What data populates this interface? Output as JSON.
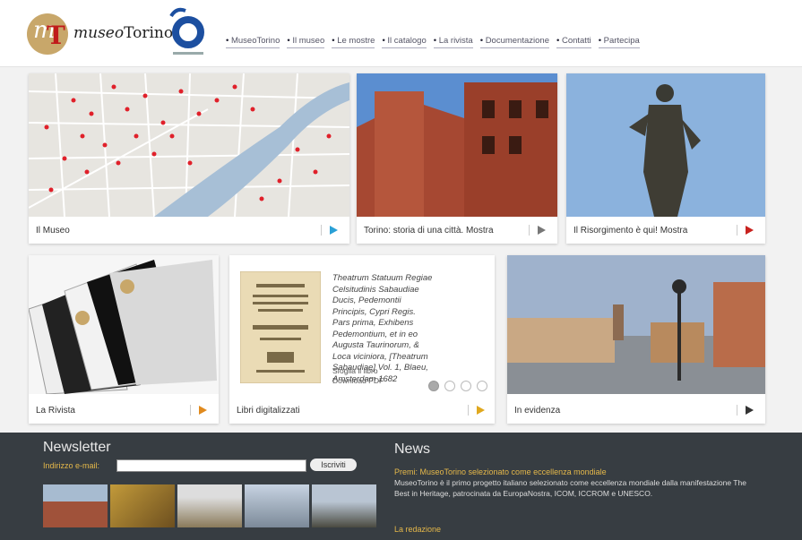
{
  "header": {
    "logo_prefix": "museo",
    "logo_suffix": "Torino",
    "nav": [
      "MuseoTorino",
      "Il museo",
      "Le mostre",
      "Il catalogo",
      "La rivista",
      "Documentazione",
      "Contatti",
      "Partecipa"
    ]
  },
  "tiles": {
    "museo": {
      "caption": "Il Museo"
    },
    "storia": {
      "caption": "Torino: storia di una città. Mostra"
    },
    "risorgimento": {
      "caption": "Il Risorgimento è qui! Mostra"
    },
    "rivista": {
      "caption": "La Rivista"
    },
    "libri": {
      "caption": "Libri digitalizzati",
      "book_title": "Theatrum Statuum Regiae Celsitudinis Sabaudiae Ducis, Pedemontii Principis, Cypri Regis. Pars prima, Exhibens Pedemontium, et in eo Augusta Taurinorum, & Loca viciniora, [Theatrum Sabaudiae] Vol. 1, Blaeu, Amsterdam 1682",
      "link_browse": "Sfoglia il libro",
      "link_download": "Download PDF"
    },
    "evidenza": {
      "caption": "In evidenza"
    }
  },
  "colors": {
    "accent_blue": "#2aa0d6",
    "accent_orange": "#e08a1e",
    "accent_red": "#c8221e",
    "footer_bg": "#373d42",
    "highlight": "#e5b84a"
  },
  "footer": {
    "newsletter_title": "Newsletter",
    "email_label": "Indirizzo e-mail:",
    "email_value": "",
    "subscribe_label": "Iscriviti",
    "news_title": "News",
    "news_headline": "Premi: MuseoTorino selezionato come eccellenza mondiale",
    "news_body": "MuseoTorino è il primo progetto italiano selezionato come eccellenza mondiale dalla manifestazione The Best in Heritage, patrocinata da EuropaNostra, ICOM, ICCROM e UNESCO.",
    "news_headline2": "La redazione"
  }
}
